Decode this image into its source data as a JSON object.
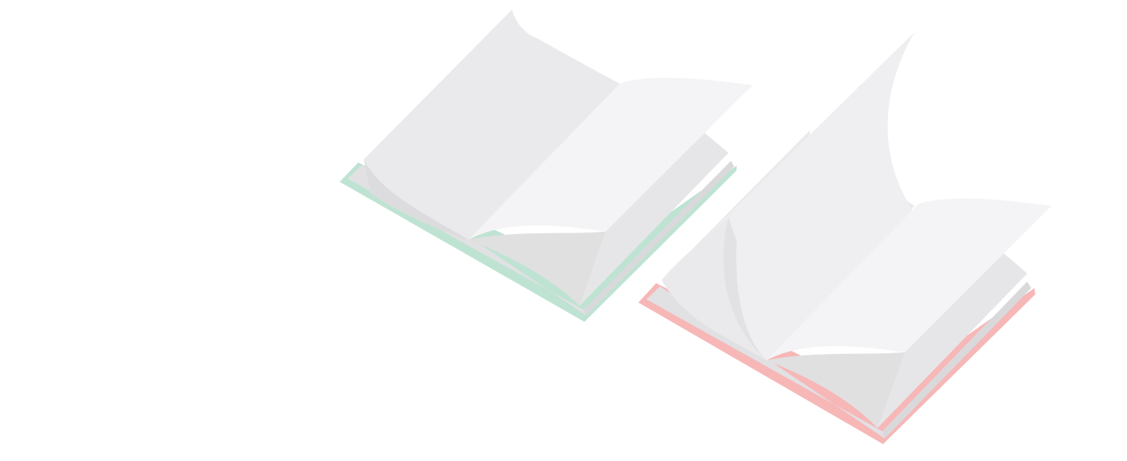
{
  "scene": {
    "background": "#ffffff",
    "books": [
      {
        "name": "green-book",
        "state": "open, right page turning",
        "cover_color": "#bfe3d2",
        "page_colors": [
          "#e5e5e7",
          "#ededef",
          "#f3f3f5"
        ]
      },
      {
        "name": "red-book",
        "state": "open, pages flipping",
        "cover_color": "#f7b7b7",
        "page_colors": [
          "#e5e5e7",
          "#ededef",
          "#f3f3f5"
        ]
      }
    ]
  }
}
